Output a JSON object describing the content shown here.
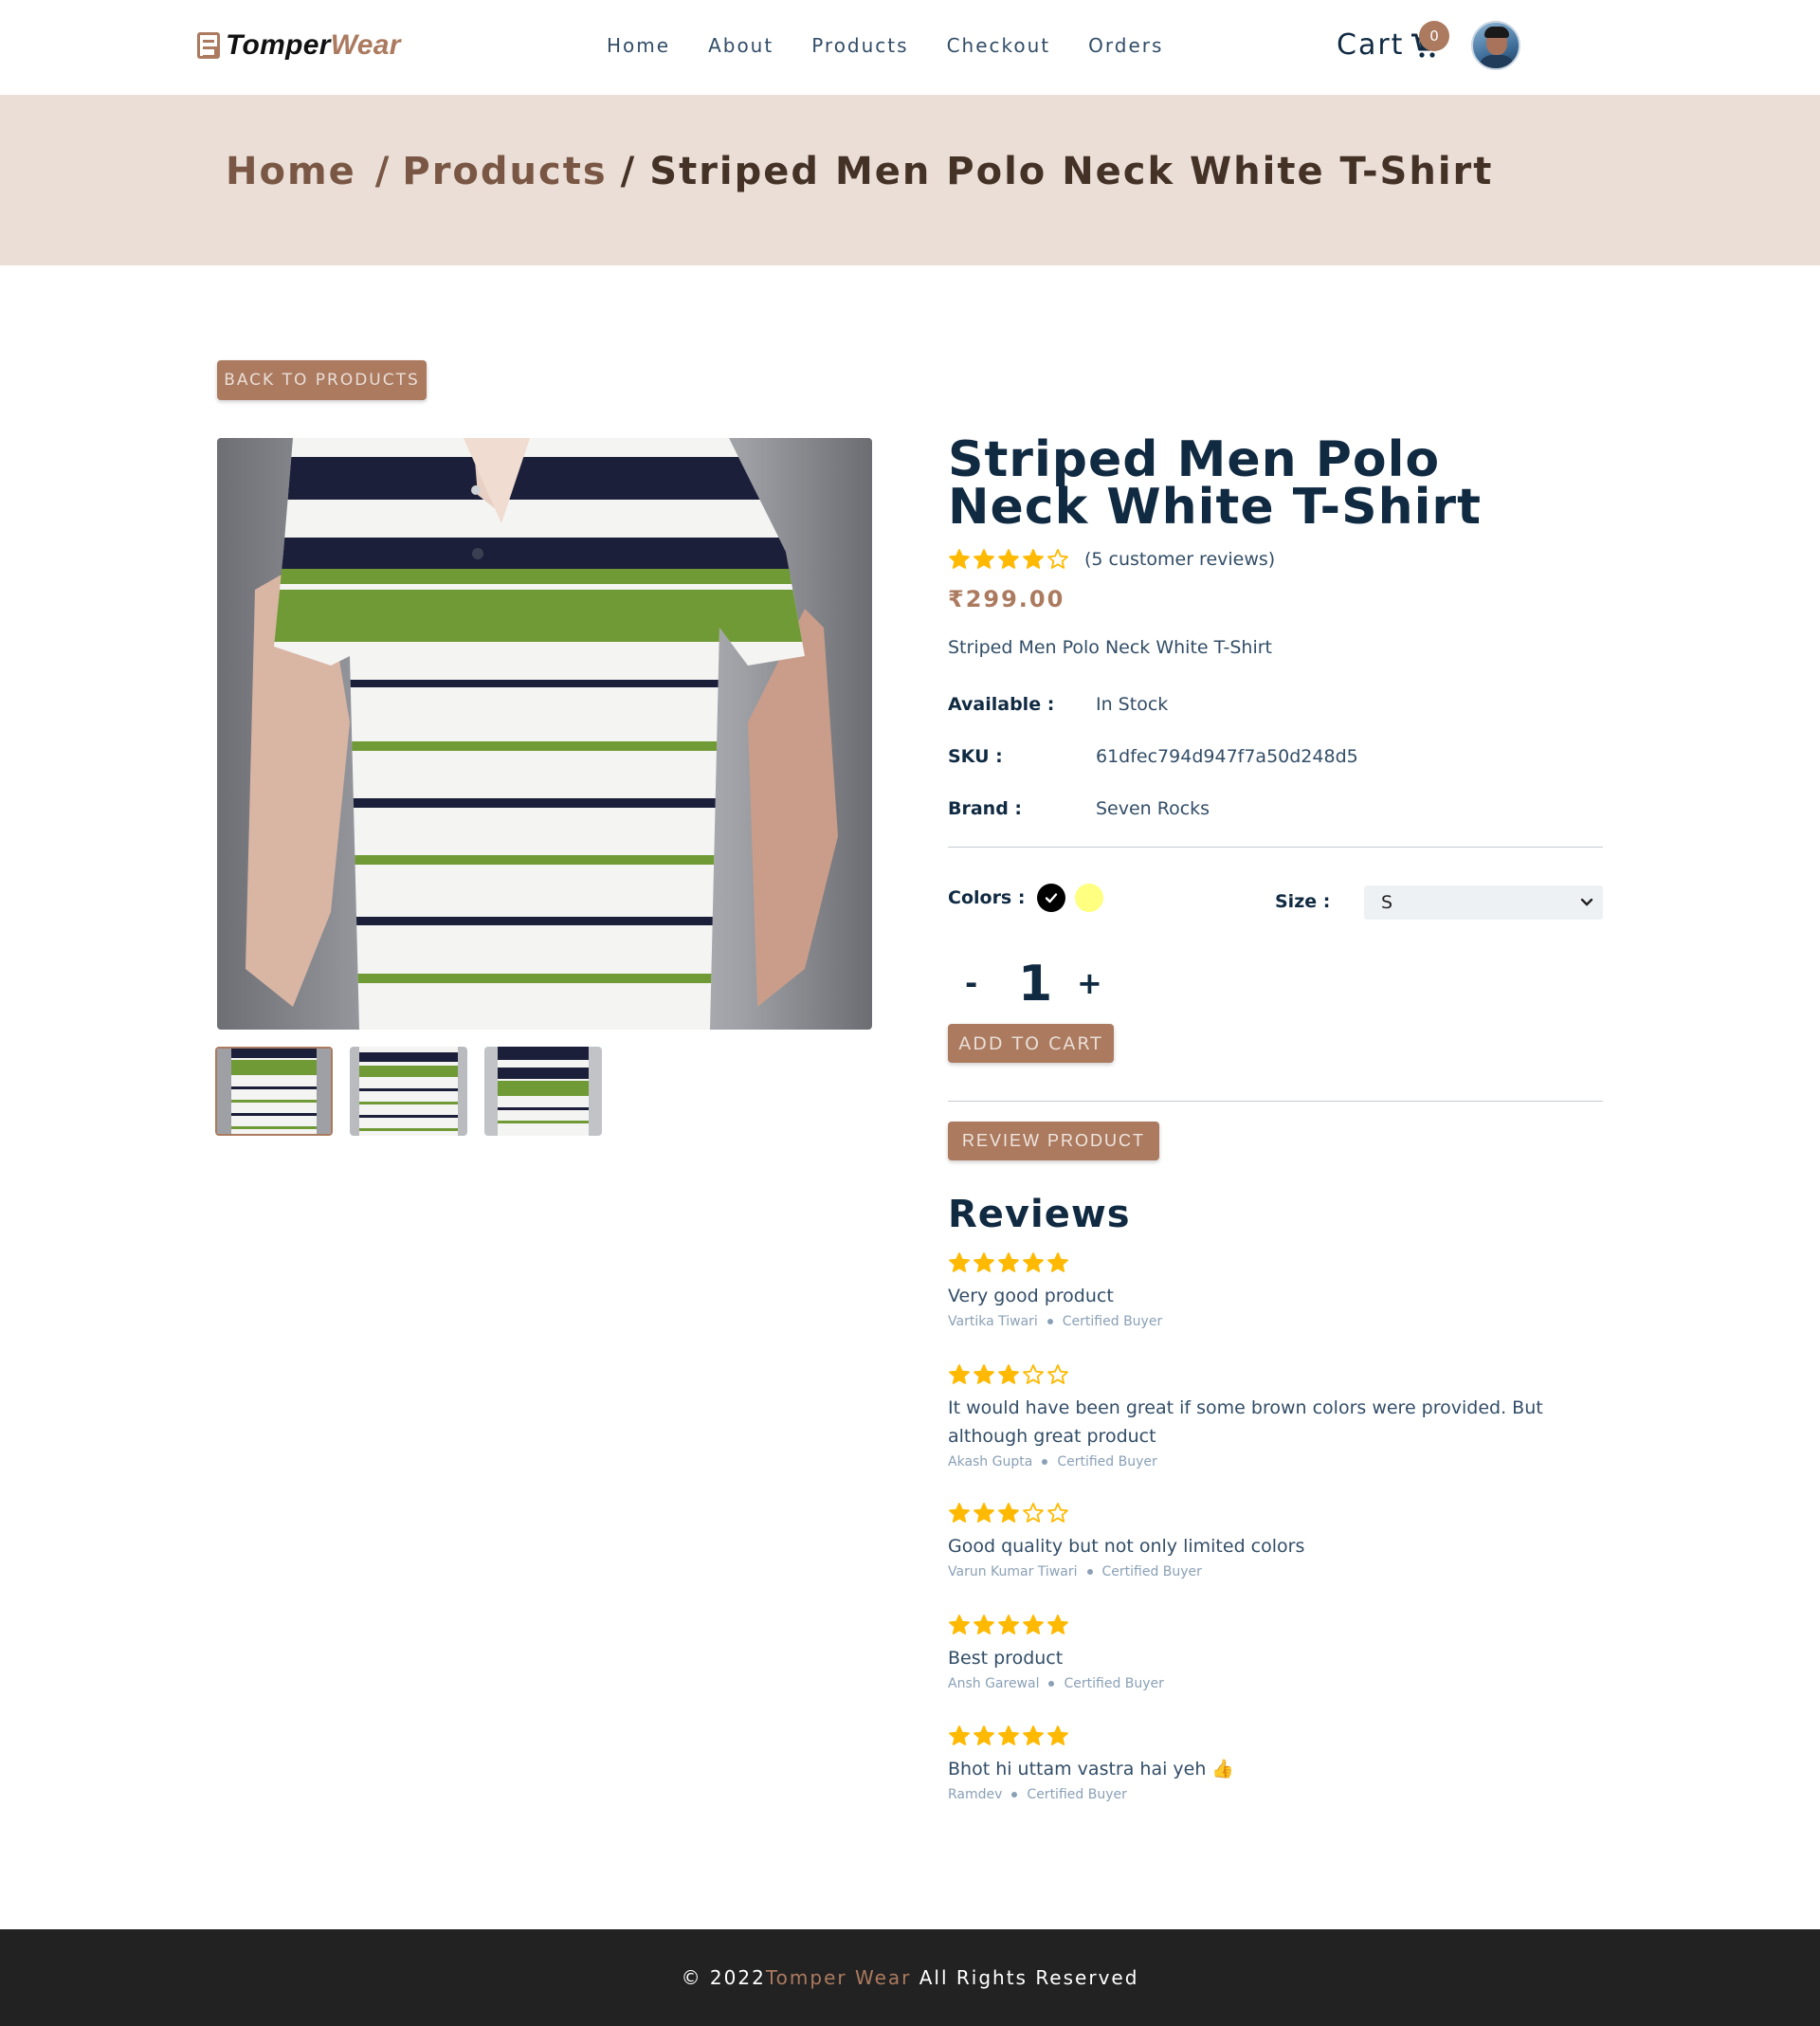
{
  "nav": {
    "logo_dark": "Tomper",
    "logo_accent": "Wear",
    "links": [
      "Home",
      "About",
      "Products",
      "Checkout",
      "Orders"
    ],
    "cart_label": "Cart",
    "cart_count": "0"
  },
  "breadcrumb": {
    "home": "Home",
    "sep1": "/",
    "products": "Products",
    "sep2": "/",
    "current": "Striped Men Polo Neck White T-Shirt"
  },
  "back_button": "Back to products",
  "product": {
    "title": "Striped Men Polo Neck White T-Shirt",
    "rating": 4,
    "review_count_text": "(5 customer reviews)",
    "price": "₹299.00",
    "description": "Striped Men Polo Neck White T-Shirt",
    "info": [
      {
        "label": "Available :",
        "value": "In Stock"
      },
      {
        "label": "SKU :",
        "value": "61dfec794d947f7a50d248d5"
      },
      {
        "label": "Brand :",
        "value": "Seven Rocks"
      }
    ],
    "colors_label": "Colors :",
    "colors": [
      "#000000",
      "#ffff80"
    ],
    "selected_color_index": 0,
    "size_label": "Size :",
    "size_value": "S",
    "quantity_minus": "-",
    "quantity": "1",
    "quantity_plus": "+",
    "add_to_cart": "Add to cart"
  },
  "review_button": "REVIEW PRODUCT",
  "reviews": {
    "heading": "Reviews",
    "items": [
      {
        "rating": 5,
        "comment": "Very good product",
        "author": "Vartika Tiwari",
        "badge": "Certified Buyer"
      },
      {
        "rating": 3,
        "comment": "It would have been great if some brown colors were provided. But although great product",
        "author": "Akash Gupta",
        "badge": "Certified Buyer"
      },
      {
        "rating": 3,
        "comment": "Good quality but not only limited colors",
        "author": "Varun Kumar Tiwari",
        "badge": "Certified Buyer"
      },
      {
        "rating": 5,
        "comment": "Best product",
        "author": "Ansh Garewal",
        "badge": "Certified Buyer"
      },
      {
        "rating": 5,
        "comment": "Bhot hi uttam vastra hai yeh 👍",
        "author": "Ramdev",
        "badge": "Certified Buyer"
      }
    ]
  },
  "footer": {
    "prefix": "© 2022",
    "brand": "Tomper Wear",
    "suffix": " All Rights Reserved"
  },
  "colors": {
    "accent": "#ab7a5f",
    "hero_bg": "#eaded7",
    "star": "#ffb900",
    "footer_bg": "#222222",
    "heading": "#102a42"
  }
}
